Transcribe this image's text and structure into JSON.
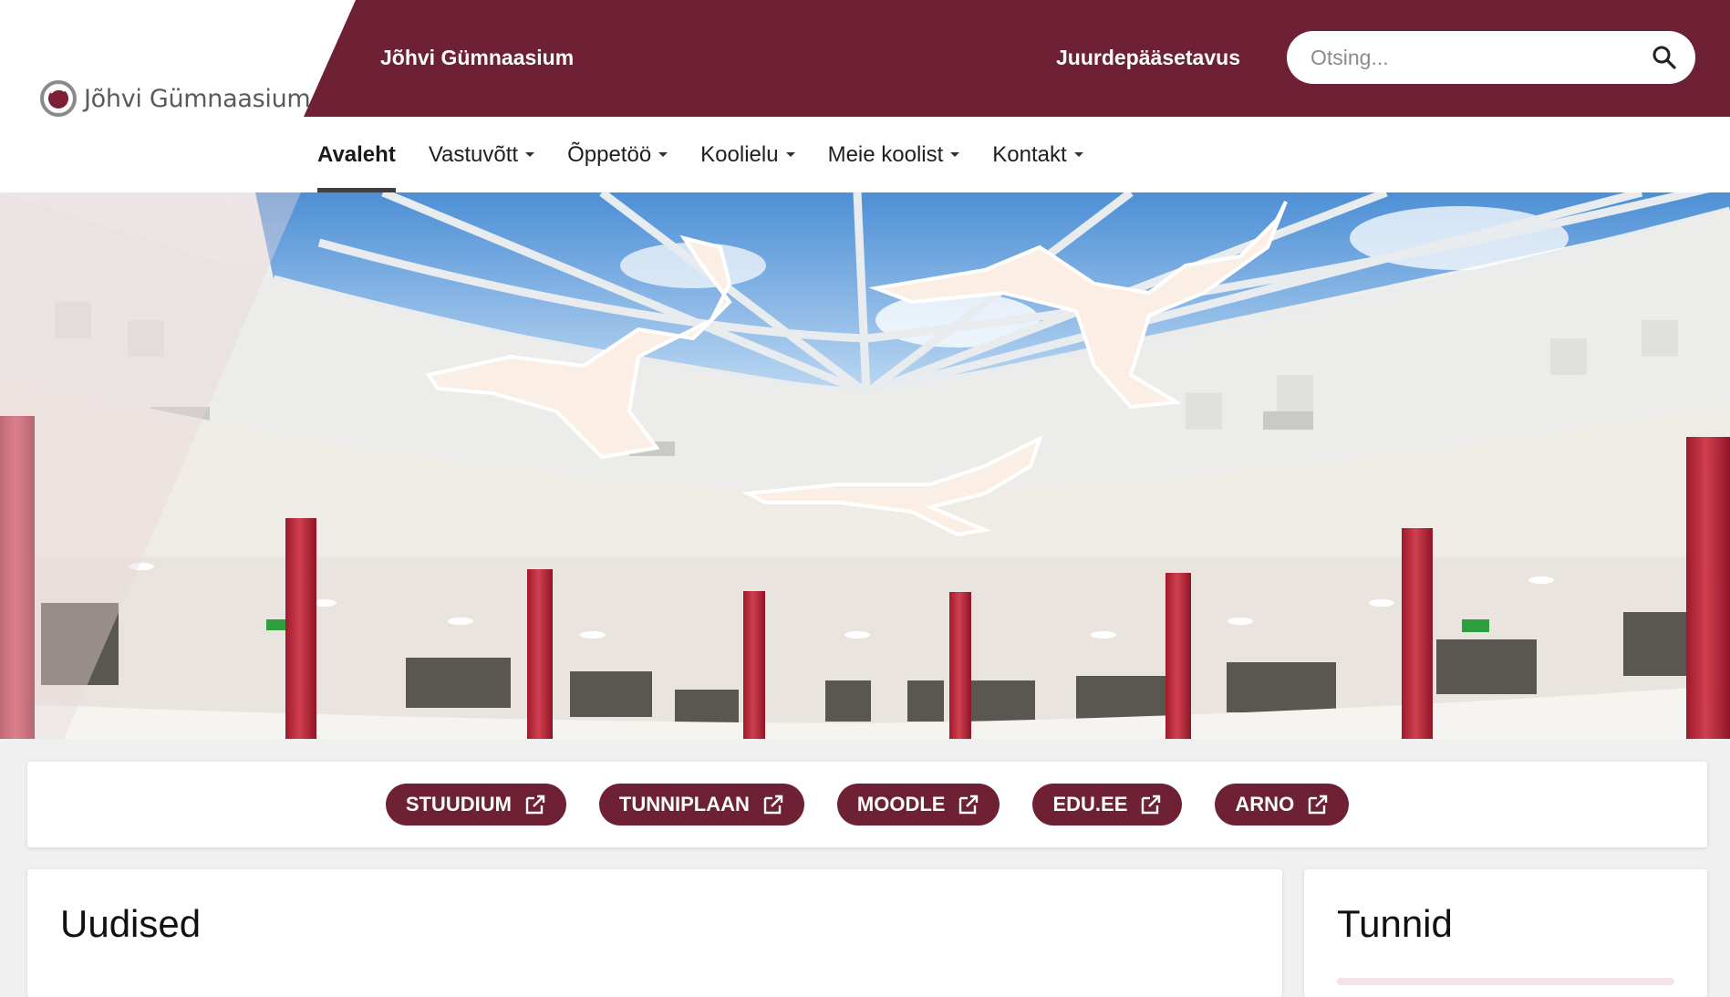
{
  "header": {
    "logo_text": "Jõhvi Gümnaasium",
    "site_name": "Jõhvi Gümnaasium",
    "accessibility_link": "Juurdepääsetavus",
    "brand_color": "#6e2034"
  },
  "search": {
    "placeholder": "Otsing...",
    "icon": "search-icon"
  },
  "nav": {
    "items": [
      {
        "label": "Avaleht",
        "active": true,
        "dropdown": false
      },
      {
        "label": "Vastuvõtt",
        "active": false,
        "dropdown": true
      },
      {
        "label": "Õppetöö",
        "active": false,
        "dropdown": true
      },
      {
        "label": "Koolielu",
        "active": false,
        "dropdown": true
      },
      {
        "label": "Meie koolist",
        "active": false,
        "dropdown": true
      },
      {
        "label": "Kontakt",
        "active": false,
        "dropdown": true
      }
    ]
  },
  "hero": {
    "image": "school atrium with glass dome and red columns"
  },
  "quicklinks": [
    {
      "label": "STUUDIUM",
      "icon": "external-link-icon"
    },
    {
      "label": "TUNNIPLAAN",
      "icon": "external-link-icon"
    },
    {
      "label": "MOODLE",
      "icon": "external-link-icon"
    },
    {
      "label": "EDU.EE",
      "icon": "external-link-icon"
    },
    {
      "label": "ARNO",
      "icon": "external-link-icon"
    }
  ],
  "sections": {
    "news_title": "Uudised",
    "lessons_title": "Tunnid"
  }
}
